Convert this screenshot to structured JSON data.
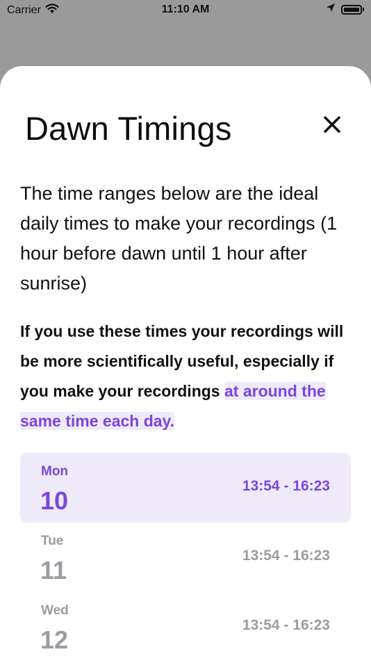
{
  "status_bar": {
    "carrier": "Carrier",
    "time": "11:10 AM",
    "icons": [
      "wifi-icon",
      "location-arrow-icon",
      "battery-icon"
    ]
  },
  "sheet": {
    "title": "Dawn Timings",
    "close_icon": "close-icon",
    "intro": "The time ranges below are the ideal daily times to make your recordings (1 hour before dawn until 1 hour after sunrise)",
    "note_text": "If you use these times your recordings will be more scientifically useful, especially if you make your recordings ",
    "note_highlight": "at around the same time each day.",
    "days": [
      {
        "weekday": "Mon",
        "date": "10",
        "range": "13:54 - 16:23",
        "selected": true
      },
      {
        "weekday": "Tue",
        "date": "11",
        "range": "13:54 - 16:23",
        "selected": false
      },
      {
        "weekday": "Wed",
        "date": "12",
        "range": "13:54 - 16:23",
        "selected": false
      }
    ]
  },
  "colors": {
    "accent": "#7a47dc",
    "accent_bg": "#efeafa",
    "muted": "#9a9ca2",
    "backdrop": "#9a9a9a"
  }
}
